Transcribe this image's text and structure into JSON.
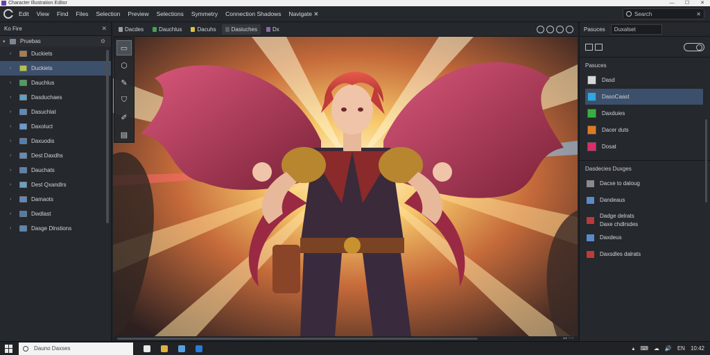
{
  "window": {
    "title": "Character Illustration Editor",
    "controls": [
      "—",
      "☐",
      "✕"
    ]
  },
  "menu": {
    "items": [
      "Edit",
      "View",
      "Find",
      "Files",
      "Selection",
      "Preview",
      "Selections",
      "Symmetry",
      "Connection Shadows",
      "Navigate ✕"
    ],
    "search_placeholder": "Search",
    "search_clear": "✕"
  },
  "layers_panel": {
    "title": "Ko  Fire",
    "close": "✕",
    "root_label": "Pruebas",
    "items": [
      {
        "label": "Duckiets",
        "color": "#b27a4a"
      },
      {
        "label": "Duckiets",
        "color": "#b5c24a",
        "selected": true
      },
      {
        "label": "Dauchlus",
        "color": "#4aa05a"
      },
      {
        "label": "Dasduchaes",
        "color": "#5aa2c8"
      },
      {
        "label": "Dasuchlat",
        "color": "#5a8ac8"
      },
      {
        "label": "Daxoluct",
        "color": "#6a9ad0"
      },
      {
        "label": "Daxuodis",
        "color": "#4f7fb8"
      },
      {
        "label": "Dest Daxdhs",
        "color": "#5b8fc0"
      },
      {
        "label": "Dauchats",
        "color": "#5a82b0"
      },
      {
        "label": "Dest Qxandlrs",
        "color": "#68a0c8"
      },
      {
        "label": "Damaots",
        "color": "#5a8ac0"
      },
      {
        "label": "Dwdlast",
        "color": "#4d7db0"
      },
      {
        "label": "Dasge Dlnstions",
        "color": "#5b86b8"
      }
    ]
  },
  "canvas_tabs": [
    {
      "label": "Dacdes",
      "color": "#9aa0a6",
      "active": false
    },
    {
      "label": "Dauchlus",
      "color": "#4aa05a",
      "active": false
    },
    {
      "label": "Dacuhs",
      "color": "#e0c040",
      "active": false
    },
    {
      "label": "Dasiuches",
      "color": "#5a6068",
      "active": true
    },
    {
      "label": "Dx",
      "color": "#8a6aa8",
      "active": false
    }
  ],
  "tools": [
    "▭",
    "⬡",
    "✎",
    "⛉",
    "✐",
    "▤"
  ],
  "canvas": {
    "scroll_label": "◂ ▸ ○ □"
  },
  "properties_panel": {
    "label": "Pasuces",
    "input_value": "Duxalset",
    "section1_title": "Pasuces",
    "swatches": [
      {
        "label": "Dasd",
        "color": "#d8d8d8"
      },
      {
        "label": "DasoCaast",
        "color": "#2aa8e8",
        "selected": true
      },
      {
        "label": "Daxduies",
        "color": "#38b040"
      },
      {
        "label": "Dacer duts",
        "color": "#e07a20"
      },
      {
        "label": "Dosat",
        "color": "#e02a6a"
      }
    ],
    "section2_title": "Dasdecies Duxges",
    "items": [
      {
        "label": "Dacxe to daloug",
        "color": "#8a8a8a"
      },
      {
        "label": "Dandeaus",
        "color": "#5a8ac8"
      },
      {
        "label": "Dadge delrats\nDaxe chdlrsdes",
        "color": "#b83a3a"
      },
      {
        "label": "Daxdeus",
        "color": "#5a8ac8"
      },
      {
        "label": "Daxsdles dalrats",
        "color": "#c03a3a"
      }
    ]
  },
  "taskbar": {
    "search_text": "Dauno Daxses",
    "apps": [
      "#e8e8e8",
      "#e0b040",
      "#58a0e0",
      "#2a7ad8"
    ],
    "tray": [
      "▴",
      "⌨",
      "☁",
      "🔊",
      "EN",
      "10:42"
    ]
  }
}
